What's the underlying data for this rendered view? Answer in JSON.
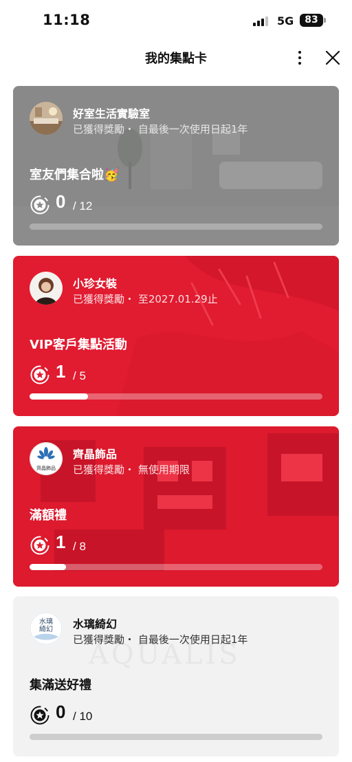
{
  "status_bar": {
    "time": "11:18",
    "network": "5G",
    "battery": "83"
  },
  "header": {
    "title": "我的集點卡",
    "more_icon": "more-vertical-icon",
    "close_icon": "close-icon"
  },
  "cards": [
    {
      "store_name": "好室生活實驗室",
      "reward_status": "已獲得獎勵",
      "separator": "・",
      "validity": "自最後一次使用日起1年",
      "campaign_title": "室友們集合啦🥳",
      "stamps_collected": "0",
      "stamps_total": "/ 12",
      "progress": 0,
      "theme": "gray",
      "theme_color": "#898989",
      "icon": "stamp-star-icon"
    },
    {
      "store_name": "小珍女裝",
      "reward_status": "已獲得獎勵",
      "separator": "・",
      "validity": "至2027.01.29止",
      "campaign_title": "VIP客戶集點活動",
      "stamps_collected": "1",
      "stamps_total": "/ 5",
      "progress": 0.2,
      "theme": "red",
      "theme_color": "#e11b30",
      "icon": "stamp-star-icon"
    },
    {
      "store_name": "齊晶飾品",
      "reward_status": "已獲得獎勵",
      "separator": "・",
      "validity": "無使用期限",
      "campaign_title": "滿額禮",
      "stamps_collected": "1",
      "stamps_total": "/ 8",
      "progress": 0.125,
      "theme": "red",
      "theme_color": "#e11b30",
      "icon": "stamp-star-icon",
      "logo_text": "齊晶飾品"
    },
    {
      "store_name": "水璃綺幻",
      "reward_status": "已獲得獎勵",
      "separator": "・",
      "validity": "自最後一次使用日起1年",
      "campaign_title": "集滿送好禮",
      "stamps_collected": "0",
      "stamps_total": "/ 10",
      "progress": 0,
      "theme": "light",
      "theme_color": "#f2f2f2",
      "icon": "stamp-star-icon",
      "logo_text": "水璃綺幻",
      "watermark_text": "AQUALIS"
    }
  ]
}
